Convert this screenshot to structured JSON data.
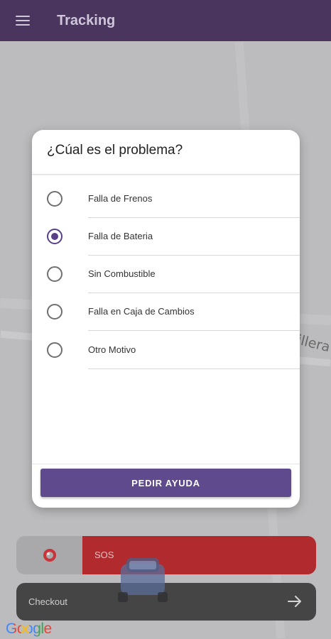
{
  "appbar": {
    "title": "Tracking",
    "menu_icon": "menu-icon",
    "color": "#4a355f"
  },
  "map": {
    "street_label": "illera"
  },
  "dialog": {
    "title": "¿Cúal es el problema?",
    "options": [
      {
        "label": "Falla de Frenos",
        "selected": false
      },
      {
        "label": "Falla de Bateria",
        "selected": true
      },
      {
        "label": "Sin Combustible",
        "selected": false
      },
      {
        "label": "Falla en Caja de Cambios",
        "selected": false
      },
      {
        "label": "Otro Motivo",
        "selected": false
      }
    ],
    "submit_label": "PEDIR AYUDA",
    "accent": "#5b3f86"
  },
  "sos": {
    "label": "SOS",
    "icon": "lifebuoy-icon",
    "color": "#b02a2e"
  },
  "checkout": {
    "label": "Checkout",
    "icon": "arrow-right-icon"
  },
  "footer": {
    "logo": "Google"
  }
}
